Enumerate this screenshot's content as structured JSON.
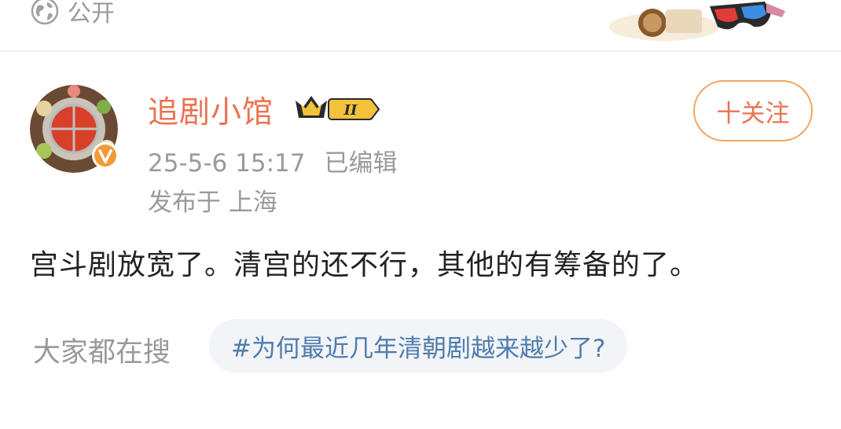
{
  "header": {
    "visibility_label": "公开",
    "visibility_icon": "globe-icon"
  },
  "post": {
    "author": "追剧小馆",
    "author_level": "II",
    "datetime": "25-5-6 15:17",
    "edited_label": "已编辑",
    "location": "发布于 上海",
    "follow_label": "十关注",
    "text": "宫斗剧放宽了。清宫的还不行，其他的有筹备的了。"
  },
  "search": {
    "label": "大家都在搜",
    "topic": "#为何最近几年清朝剧越来越少了?"
  },
  "colors": {
    "accent_orange": "#eb7350",
    "follow_border": "#f5a35e",
    "topic_link": "#4f7cae",
    "muted_text": "#9a9a9a"
  }
}
